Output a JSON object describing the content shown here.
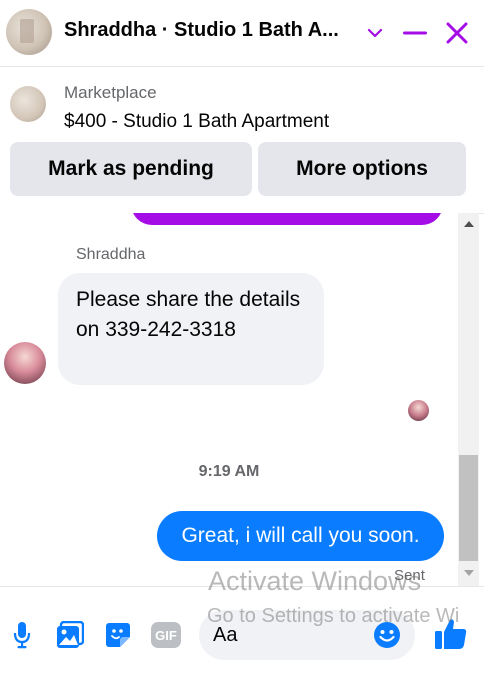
{
  "header": {
    "title": "Shraddha · Studio 1 Bath A...",
    "accent_color": "#a50de6"
  },
  "marketplace": {
    "label": "Marketplace",
    "item_title": "$400 - Studio 1 Bath Apartment",
    "mark_pending_label": "Mark as pending",
    "more_options_label": "More options"
  },
  "chat": {
    "sender_name": "Shraddha",
    "incoming_message": "Please share the details on 339-242-3318",
    "timestamp": "9:19 AM",
    "outgoing_message": "Great, i will call you soon.",
    "status": "Sent",
    "outgoing_color": "#0a7cff"
  },
  "composer": {
    "placeholder": "Aa"
  },
  "bottom_icons": [
    "microphone-icon",
    "photo-icon",
    "sticker-icon",
    "gif-icon",
    "emoji-icon",
    "thumbs-up-icon"
  ],
  "watermark": {
    "line1": "Activate Windows",
    "line2": "Go to Settings to activate Wi"
  }
}
